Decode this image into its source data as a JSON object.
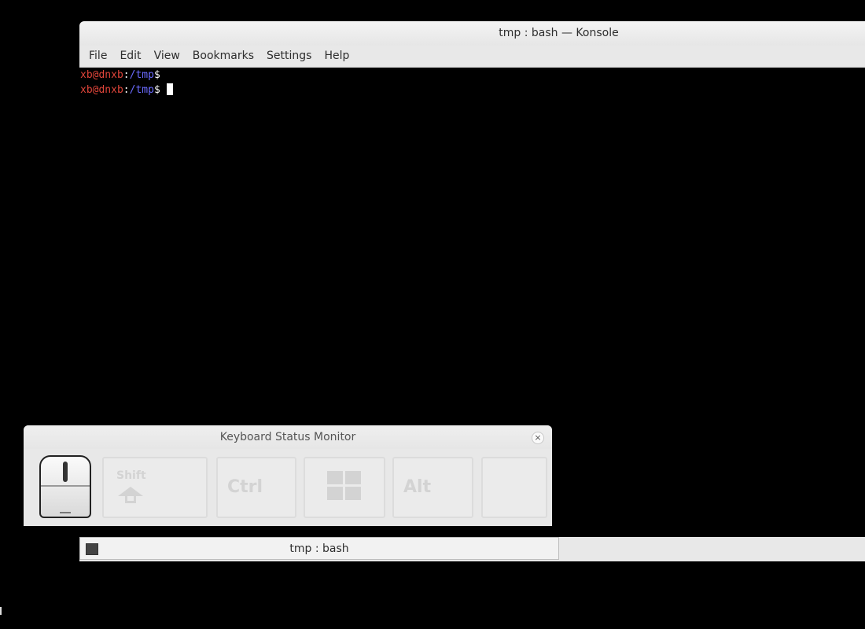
{
  "konsole": {
    "title": "tmp : bash — Konsole",
    "menu": [
      "File",
      "Edit",
      "View",
      "Bookmarks",
      "Settings",
      "Help"
    ],
    "lines": [
      {
        "user": "xb@dnxb",
        "sep": ":",
        "path": "/tmp",
        "prompt": "$"
      },
      {
        "user": "xb@dnxb",
        "sep": ":",
        "path": "/tmp",
        "prompt": "$"
      }
    ]
  },
  "ksm": {
    "title": "Keyboard Status Monitor",
    "close": "×",
    "keys": {
      "shift": "Shift",
      "ctrl": "Ctrl",
      "alt": "Alt"
    }
  },
  "taskbar": {
    "item_label": "tmp : bash"
  },
  "colors": {
    "user": "#e0453a",
    "path": "#6b6bff"
  }
}
